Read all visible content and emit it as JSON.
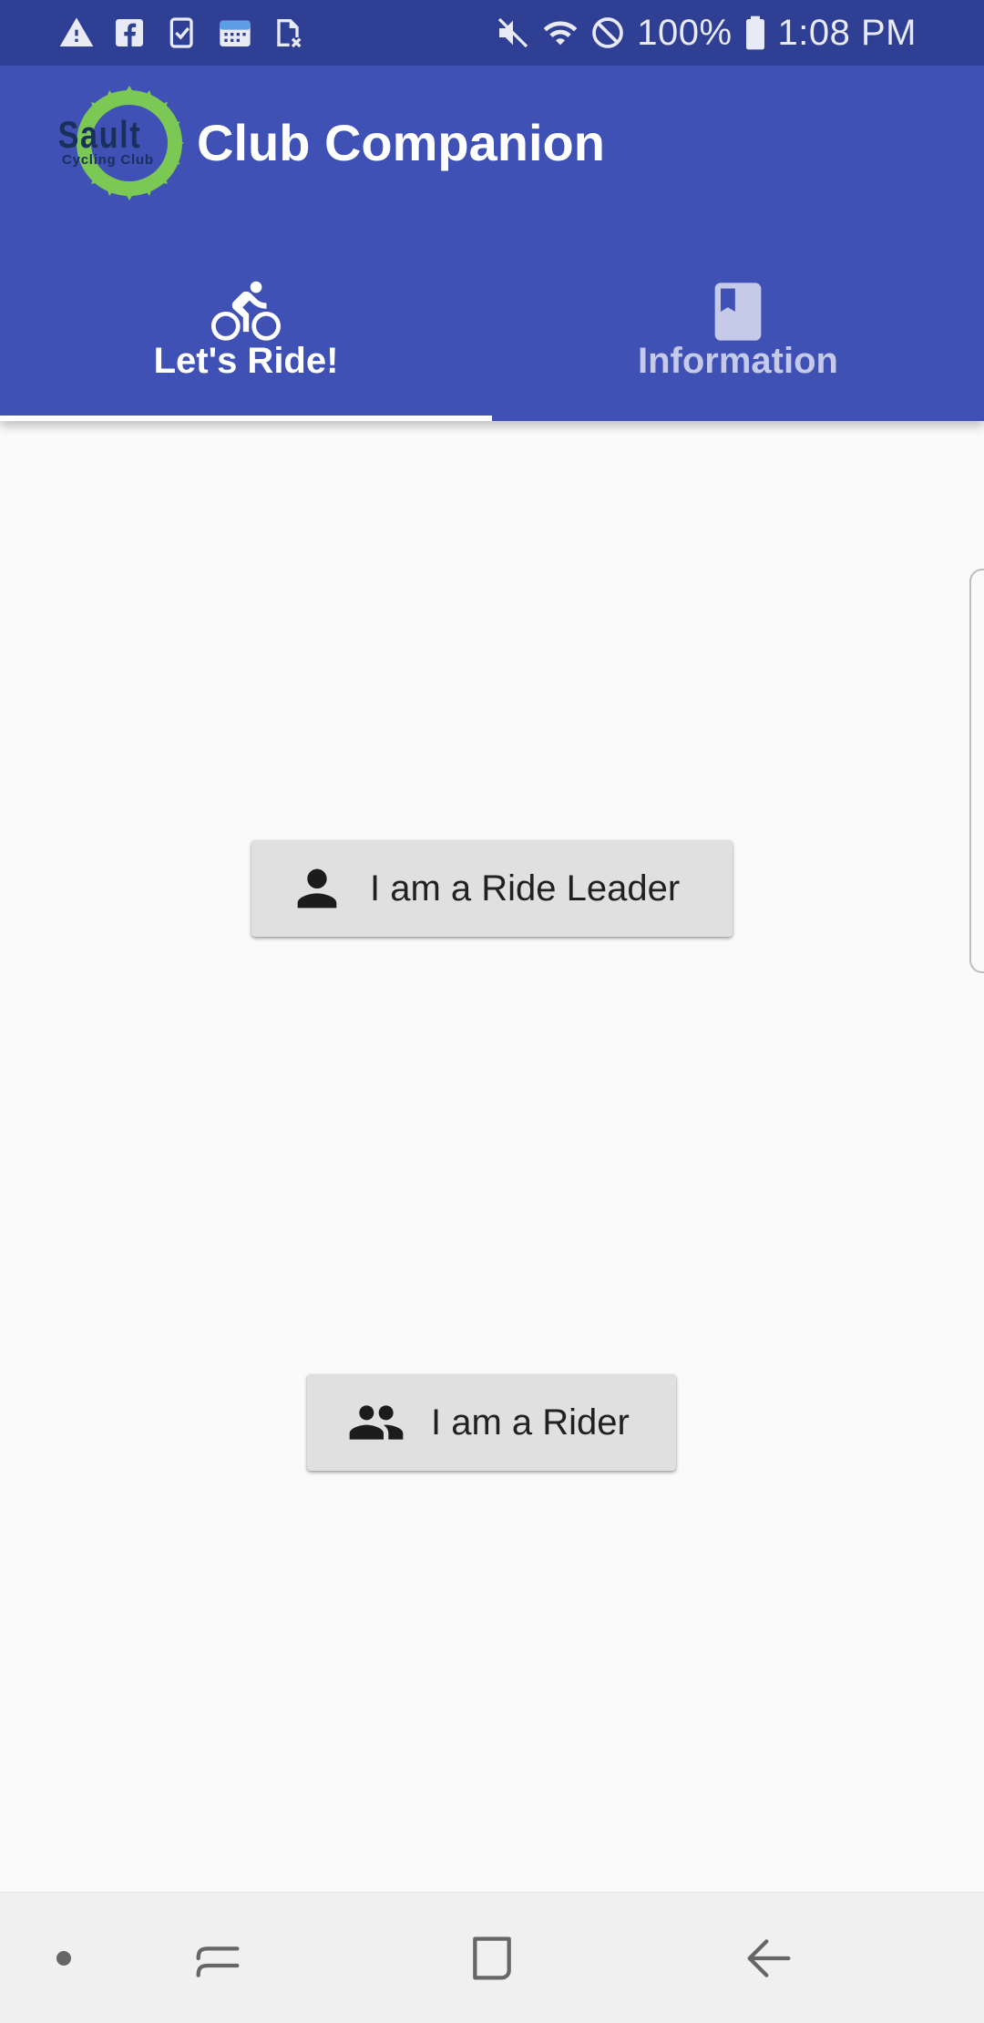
{
  "status_bar": {
    "time": "1:08 PM",
    "battery": "100%",
    "left_icons": [
      "warning-icon",
      "facebook-icon",
      "clipboard-check-icon",
      "calendar-cloud-icon",
      "sim-off-icon"
    ],
    "right_icons": [
      "mute-icon",
      "wifi-icon",
      "do-not-disturb-icon",
      "battery-icon"
    ]
  },
  "app_bar": {
    "title": "Club Companion",
    "logo": {
      "line1": "Sault",
      "line2": "Cycling Club"
    }
  },
  "tabs": [
    {
      "label": "Let's Ride!",
      "icon": "bike-icon",
      "selected": true
    },
    {
      "label": "Information",
      "icon": "book-icon",
      "selected": false
    }
  ],
  "buttons": {
    "leader": {
      "label": "I am a Ride Leader",
      "icon": "person-icon"
    },
    "rider": {
      "label": "I am a Rider",
      "icon": "group-icon"
    }
  },
  "nav_bar": {
    "buttons": [
      "dot-icon",
      "recents-icon",
      "home-icon",
      "back-icon"
    ]
  },
  "colors": {
    "status_bar": "#2f3f94",
    "app_bar": "#3f51b5",
    "tab_inactive_text": "#c5cae9",
    "button_bg": "#e0e0e0",
    "background": "#fafafa",
    "logo_green": "#7cc855"
  }
}
